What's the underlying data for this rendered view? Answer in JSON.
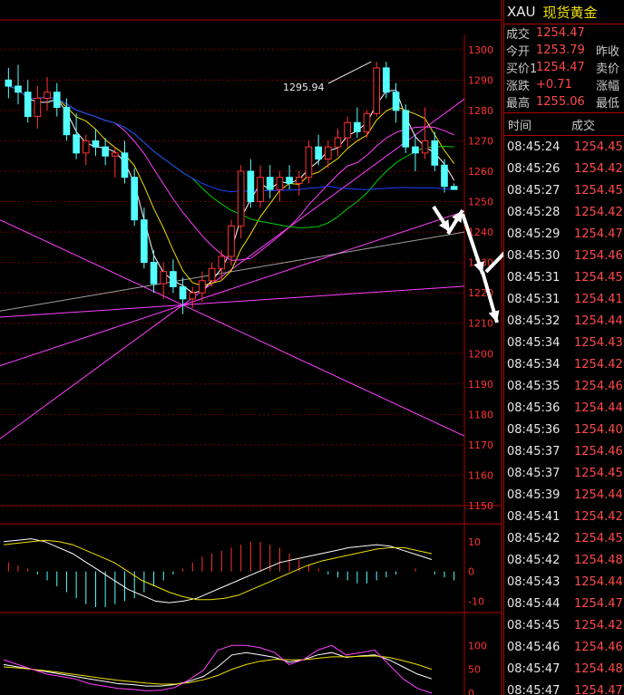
{
  "quote": {
    "symbol": "XAU",
    "name": "现货黄金",
    "rows": [
      {
        "label": "成交",
        "value": "1254.47",
        "extra": ""
      },
      {
        "label": "今开",
        "value": "1253.79",
        "extra": "昨收"
      },
      {
        "label": "买价1",
        "value": "1254.47",
        "extra": "卖价"
      },
      {
        "label": "涨跌",
        "value": "+0.71",
        "extra": "涨幅"
      },
      {
        "label": "最高",
        "value": "1255.06",
        "extra": "最低"
      }
    ]
  },
  "ticks": {
    "time_header": "时间",
    "price_header": "成交",
    "rows": [
      {
        "time": "08:45:24",
        "price": "1254.45"
      },
      {
        "time": "08:45:26",
        "price": "1254.42"
      },
      {
        "time": "08:45:27",
        "price": "1254.45"
      },
      {
        "time": "08:45:28",
        "price": "1254.42"
      },
      {
        "time": "08:45:29",
        "price": "1254.47"
      },
      {
        "time": "08:45:30",
        "price": "1254.46"
      },
      {
        "time": "08:45:31",
        "price": "1254.45"
      },
      {
        "time": "08:45:31",
        "price": "1254.41"
      },
      {
        "time": "08:45:32",
        "price": "1254.44"
      },
      {
        "time": "08:45:34",
        "price": "1254.43"
      },
      {
        "time": "08:45:34",
        "price": "1254.42"
      },
      {
        "time": "08:45:35",
        "price": "1254.46"
      },
      {
        "time": "08:45:36",
        "price": "1254.44"
      },
      {
        "time": "08:45:36",
        "price": "1254.40"
      },
      {
        "time": "08:45:37",
        "price": "1254.46"
      },
      {
        "time": "08:45:37",
        "price": "1254.45"
      },
      {
        "time": "08:45:39",
        "price": "1254.44"
      },
      {
        "time": "08:45:41",
        "price": "1254.42"
      },
      {
        "time": "08:45:42",
        "price": "1254.45"
      },
      {
        "time": "08:45:42",
        "price": "1254.48"
      },
      {
        "time": "08:45:43",
        "price": "1254.44"
      },
      {
        "time": "08:45:44",
        "price": "1254.47"
      },
      {
        "time": "08:45:45",
        "price": "1254.42"
      },
      {
        "time": "08:45:46",
        "price": "1254.46"
      },
      {
        "time": "08:45:47",
        "price": "1254.48"
      },
      {
        "time": "08:45:47",
        "price": "1254.47"
      }
    ]
  },
  "colors": {
    "up": "#ff3232",
    "down": "#54ffff",
    "frame": "#b00000",
    "grid": "#7a0000",
    "ma1": "#ffffff",
    "ma2": "#f0e000",
    "ma3": "#ff40ff",
    "ma4": "#00d000",
    "ma5": "#2040ff",
    "trend": "#ff40ff",
    "trend2": "#a0a0a0",
    "axis_text": "#ff3232"
  },
  "chart_data": [
    {
      "type": "candlestick",
      "annotation": "1295.94",
      "ylim": [
        1150,
        1305
      ],
      "y_ticks": [
        1300,
        1290,
        1280,
        1270,
        1260,
        1250,
        1240,
        1230,
        1220,
        1210,
        1200,
        1190,
        1180,
        1170,
        1160,
        1150
      ],
      "candles": [
        [
          1290,
          1294,
          1284,
          1288
        ],
        [
          1288,
          1295,
          1282,
          1286
        ],
        [
          1286,
          1290,
          1276,
          1278
        ],
        [
          1278,
          1288,
          1274,
          1284
        ],
        [
          1284,
          1291,
          1280,
          1286
        ],
        [
          1286,
          1289,
          1278,
          1281
        ],
        [
          1281,
          1284,
          1270,
          1272
        ],
        [
          1272,
          1279,
          1264,
          1266
        ],
        [
          1266,
          1272,
          1262,
          1270
        ],
        [
          1270,
          1274,
          1265,
          1268
        ],
        [
          1268,
          1271,
          1262,
          1265
        ],
        [
          1265,
          1268,
          1258,
          1266
        ],
        [
          1266,
          1270,
          1256,
          1258
        ],
        [
          1258,
          1261,
          1242,
          1244
        ],
        [
          1244,
          1248,
          1228,
          1230
        ],
        [
          1230,
          1234,
          1220,
          1223
        ],
        [
          1223,
          1230,
          1218,
          1227
        ],
        [
          1227,
          1231,
          1220,
          1222
        ],
        [
          1222,
          1225,
          1213,
          1218
        ],
        [
          1218,
          1222,
          1215,
          1220
        ],
        [
          1220,
          1227,
          1217,
          1224
        ],
        [
          1224,
          1230,
          1222,
          1228
        ],
        [
          1228,
          1234,
          1224,
          1232
        ],
        [
          1232,
          1244,
          1229,
          1242
        ],
        [
          1242,
          1262,
          1238,
          1260
        ],
        [
          1260,
          1264,
          1248,
          1250
        ],
        [
          1250,
          1262,
          1248,
          1258
        ],
        [
          1258,
          1262,
          1251,
          1254
        ],
        [
          1254,
          1260,
          1250,
          1258
        ],
        [
          1258,
          1262,
          1254,
          1256
        ],
        [
          1256,
          1260,
          1252,
          1258
        ],
        [
          1258,
          1270,
          1256,
          1268
        ],
        [
          1268,
          1272,
          1262,
          1264
        ],
        [
          1264,
          1270,
          1261,
          1268
        ],
        [
          1268,
          1274,
          1265,
          1271
        ],
        [
          1271,
          1278,
          1268,
          1276
        ],
        [
          1276,
          1281,
          1271,
          1273
        ],
        [
          1273,
          1280,
          1271,
          1279
        ],
        [
          1279,
          1296,
          1278,
          1294
        ],
        [
          1294,
          1296,
          1284,
          1286
        ],
        [
          1286,
          1289,
          1276,
          1280
        ],
        [
          1280,
          1282,
          1266,
          1268
        ],
        [
          1268,
          1272,
          1260,
          1266
        ],
        [
          1266,
          1281,
          1264,
          1270
        ],
        [
          1270,
          1273,
          1260,
          1262
        ],
        [
          1262,
          1264,
          1253,
          1255
        ],
        [
          1255,
          1256,
          1254,
          1254
        ]
      ],
      "macd": {
        "ylim": [
          -12,
          13
        ],
        "y_ticks": [
          10,
          0,
          -10
        ],
        "hist": [
          3,
          2,
          1,
          -1,
          -3,
          -5,
          -7,
          -9,
          -11,
          -12,
          -12,
          -11,
          -10,
          -9,
          -7,
          -5,
          -3,
          -1,
          1,
          3,
          5,
          6,
          7,
          8,
          9,
          10,
          10,
          9,
          8,
          6,
          4,
          2,
          1,
          -1,
          -2,
          -3,
          -4,
          -4,
          -3,
          -2,
          -1,
          0,
          1,
          0,
          -1,
          -2,
          -3
        ],
        "dif": [
          10,
          10.5,
          11,
          10,
          8,
          6,
          3,
          0,
          -3,
          -6,
          -8,
          -10,
          -10.5,
          -10,
          -9,
          -7,
          -5,
          -3,
          -1,
          1,
          3,
          4,
          5,
          6,
          7,
          8,
          8.5,
          9,
          8.5,
          7,
          5.5,
          4
        ],
        "dea": [
          9,
          9.5,
          10,
          10.5,
          10,
          9,
          7,
          5,
          3,
          0,
          -3,
          -5,
          -7,
          -8.5,
          -9.5,
          -9.5,
          -9,
          -8,
          -6,
          -4,
          -2,
          0,
          2,
          3.5,
          4.5,
          5.5,
          6.5,
          7.5,
          8,
          8,
          7,
          6
        ]
      },
      "kdj": {
        "ylim": [
          0,
          110
        ],
        "y_ticks": [
          100,
          50,
          0
        ],
        "k": [
          60,
          55,
          50,
          45,
          40,
          35,
          30,
          25,
          20,
          18,
          15,
          15,
          18,
          25,
          35,
          55,
          80,
          85,
          80,
          75,
          65,
          70,
          80,
          85,
          75,
          78,
          80,
          70,
          55,
          40,
          30
        ],
        "d": [
          55,
          53,
          50,
          47,
          43,
          39,
          35,
          31,
          27,
          24,
          21,
          19,
          19,
          22,
          28,
          37,
          50,
          60,
          67,
          71,
          70,
          70,
          73,
          76,
          76,
          77,
          78,
          75,
          68,
          60,
          50
        ],
        "j": [
          70,
          60,
          50,
          40,
          35,
          30,
          20,
          15,
          10,
          8,
          5,
          6,
          12,
          28,
          48,
          90,
          100,
          100,
          95,
          85,
          60,
          70,
          90,
          100,
          80,
          85,
          90,
          60,
          30,
          10,
          0
        ]
      }
    }
  ]
}
